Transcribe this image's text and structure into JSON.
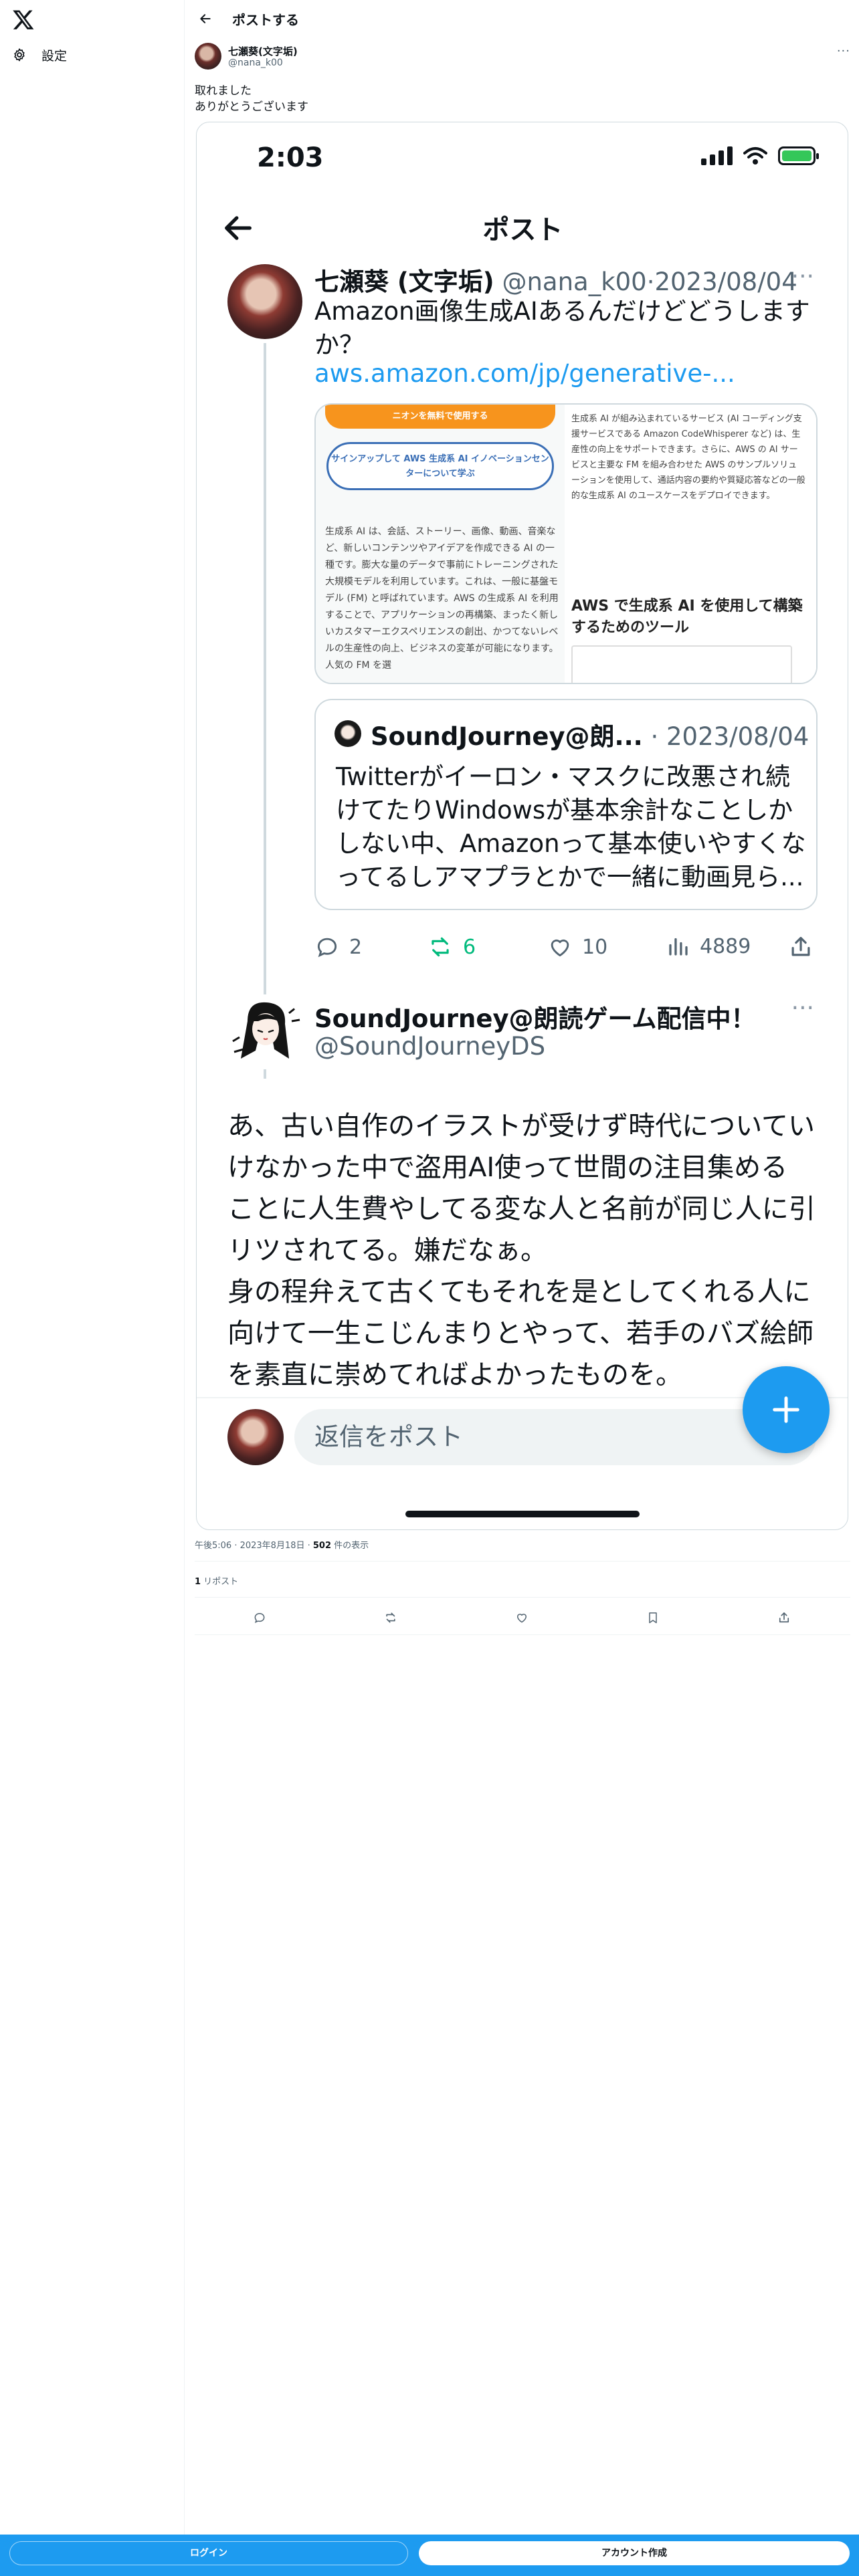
{
  "nav": {
    "logo": "x-logo-icon",
    "settings_label": "設定"
  },
  "topbar": {
    "title": "ポストする"
  },
  "post": {
    "author_name": "七瀬葵(文字垢)",
    "author_handle": "@nana_k00",
    "text_lines": [
      "取れました",
      "ありがとうございます"
    ],
    "meta_time": "午後5:06 · 2023年8月18日 · ",
    "meta_views_count": "502",
    "meta_views_label": " 件の表示",
    "reposts_count": "1",
    "reposts_label": " リポスト"
  },
  "screenshot": {
    "status_time": "2:03",
    "header_title": "ポスト",
    "tweet1": {
      "name": "七瀬葵 (文字垢)",
      "handle": " @nana_k00·2023/08/04",
      "lines": [
        "Amazon画像生成AIあるんだけどどうします",
        "か？"
      ],
      "link": "aws.amazon.com/jp/generative-..."
    },
    "card": {
      "orange_label": "ニオンを無料で使用する",
      "blue_button": "サインアップして AWS 生成系 AI イノベーションセンターについて学ぶ",
      "left_text": "生成系 AI は、会話、ストーリー、画像、動画、音楽など、新しいコンテンツやアイデアを作成できる AI の一種です。膨大な量のデータで事前にトレーニングされた大規模モデルを利用しています。これは、一般に基盤モデル (FM) と呼ばれています。AWS の生成系 AI を利用することで、アプリケーションの再構築、まったく新しいカスタマーエクスペリエンスの創出、かつてないレベルの生産性の向上、ビジネスの変革が可能になります。人気の FM を選",
      "right_text": "生成系 AI が組み込まれているサービス (AI コーディング支援サービスである Amazon CodeWhisperer など) は、生産性の向上をサポートできます。さらに、AWS の AI サービスと主要な FM を組み合わせた AWS のサンプルソリューションを使用して、通話内容の要約や質疑応答などの一般的な生成系 AI のユースケースをデプロイできます。",
      "heading": "AWS で生成系 AI を使用して構築するためのツール"
    },
    "quote": {
      "name": "SoundJourney@朗...",
      "handle": " · 2023/08/04",
      "lines": [
        "Twitterがイーロン・マスクに改悪され続",
        "けてたりWindowsが基本余計なことしか",
        "しない中、Amazonって基本使いやすくな",
        "ってるしアマプラとかで一緒に動画見ら..."
      ]
    },
    "actions": {
      "replies": "2",
      "reposts": "6",
      "likes": "10",
      "views": "4889"
    },
    "tweet2": {
      "name": "SoundJourney@朗読ゲーム配信中！",
      "handle": "@SoundJourneyDS",
      "lines": [
        "あ、古い自作のイラストが受けず時代についてい",
        "けなかった中で盗用AI使って世間の注目集める",
        "ことに人生費やしてる変な人と名前が同じ人に引",
        "リツされてる。嫌だなぁ。",
        "身の程弁えて古くてもそれを是としてくれる人に",
        "向けて一生こじんまりとやって、若手のバズ絵師",
        "を素直に崇めてればよかったものを。"
      ]
    },
    "reply_placeholder": "返信をポスト"
  },
  "bottom_bar": {
    "login": "ログイン",
    "signup": "アカウント作成"
  },
  "colors": {
    "accent": "#1d9bf0",
    "repost_green": "#00ba7c",
    "text": "#0f1419",
    "secondary": "#536471"
  }
}
